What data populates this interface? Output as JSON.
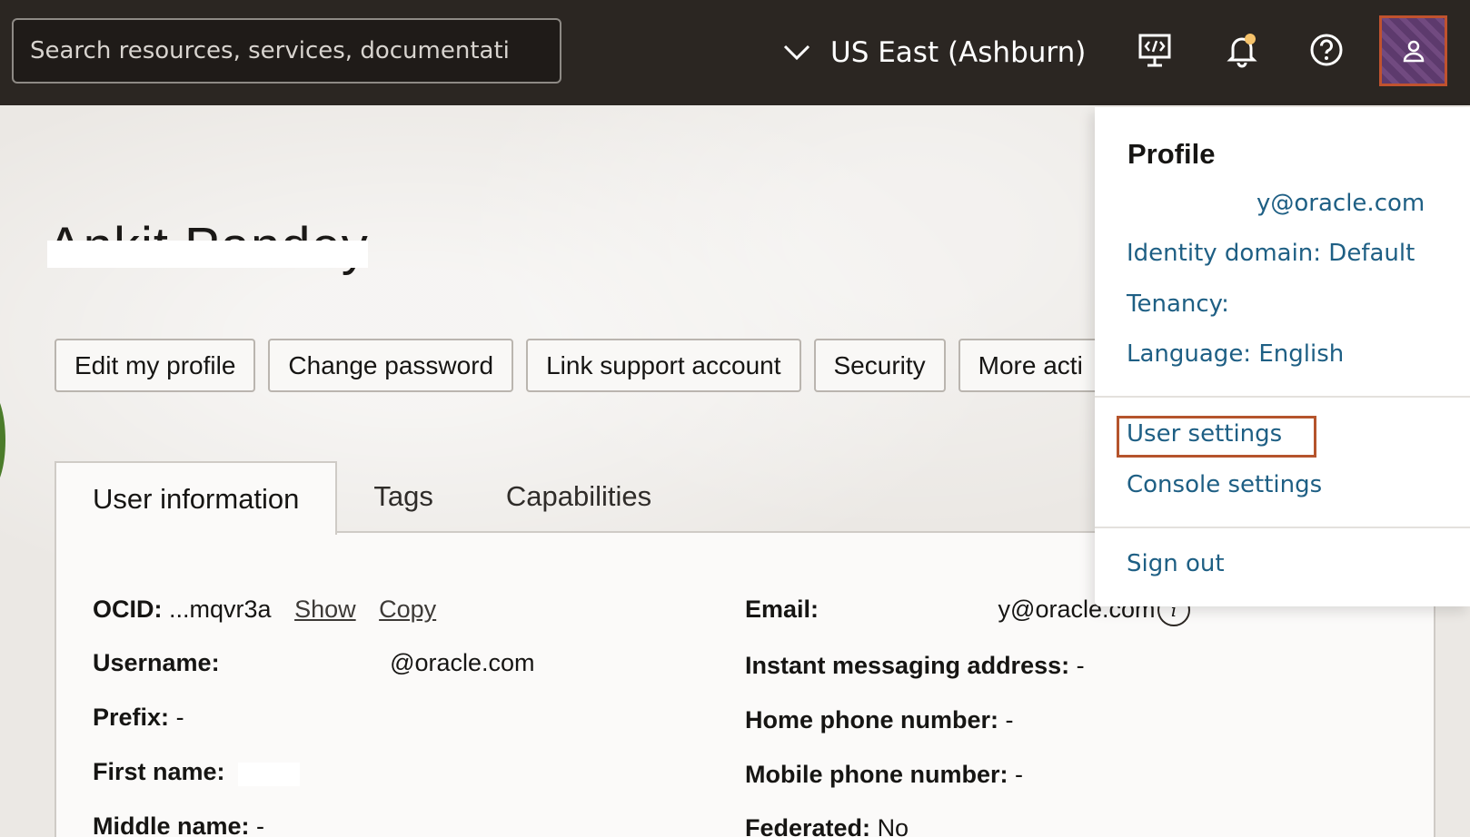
{
  "topbar": {
    "search_placeholder": "Search resources, services, documentati",
    "region": "US East (Ashburn)",
    "icons": [
      "chevron-down-icon",
      "cloud-shell-icon",
      "bell-icon",
      "help-icon",
      "user-icon"
    ]
  },
  "profile_page": {
    "user_name": "Ankit Pandey",
    "actions": [
      "Edit my profile",
      "Change password",
      "Link support account",
      "Security",
      "More acti"
    ],
    "tabs": [
      "User information",
      "Tags",
      "Capabilities"
    ],
    "fields": {
      "ocid_label": "OCID:",
      "ocid_value": "...mqvr3a",
      "show": "Show",
      "copy": "Copy",
      "username_label": "Username:",
      "username_value": "@oracle.com",
      "prefix_label": "Prefix:",
      "prefix_value": "-",
      "first_name_label": "First name:",
      "first_name_value": "",
      "middle_name_label": "Middle name:",
      "middle_name_value": "-",
      "email_label": "Email:",
      "email_value": "y@oracle.com",
      "im_label": "Instant messaging address:",
      "im_value": "-",
      "home_phone_label": "Home phone number:",
      "home_phone_value": "-",
      "mobile_phone_label": "Mobile phone number:",
      "mobile_phone_value": "-",
      "federated_label": "Federated:",
      "federated_value": "No"
    }
  },
  "profile_menu": {
    "title": "Profile",
    "email": "y@oracle.com",
    "identity_domain": "Identity domain: Default",
    "tenancy": "Tenancy:",
    "language": "Language: English",
    "user_settings": "User settings",
    "console_settings": "Console settings",
    "sign_out": "Sign out"
  },
  "colors": {
    "topbar": "#2b2622",
    "menu_link": "#1e5f84",
    "highlight": "#b5542c",
    "notification_dot": "#f5c26b"
  }
}
